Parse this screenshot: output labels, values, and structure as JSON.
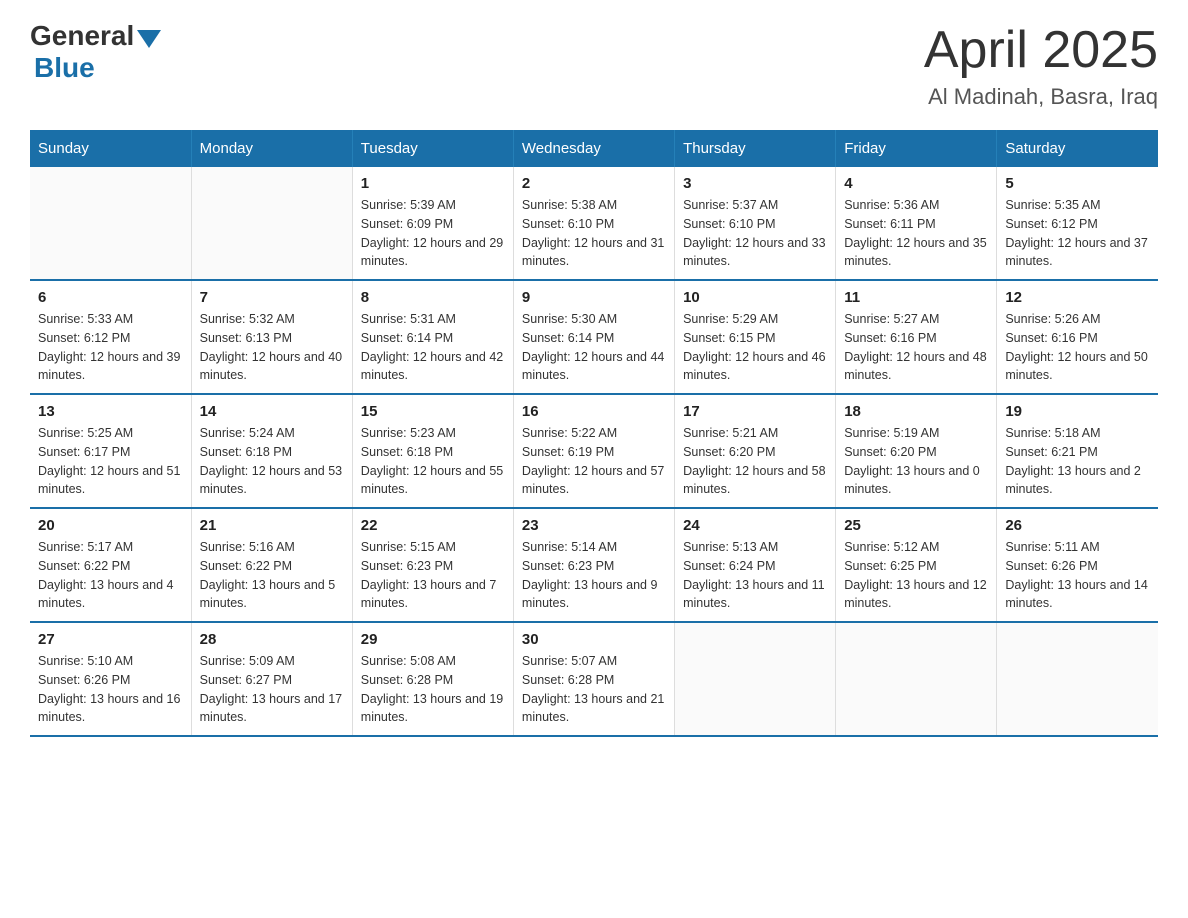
{
  "header": {
    "logo_general": "General",
    "logo_blue": "Blue",
    "title": "April 2025",
    "subtitle": "Al Madinah, Basra, Iraq"
  },
  "days_of_week": [
    "Sunday",
    "Monday",
    "Tuesday",
    "Wednesday",
    "Thursday",
    "Friday",
    "Saturday"
  ],
  "weeks": [
    [
      {
        "empty": true
      },
      {
        "empty": true
      },
      {
        "day": 1,
        "sunrise": "5:39 AM",
        "sunset": "6:09 PM",
        "daylight": "12 hours and 29 minutes."
      },
      {
        "day": 2,
        "sunrise": "5:38 AM",
        "sunset": "6:10 PM",
        "daylight": "12 hours and 31 minutes."
      },
      {
        "day": 3,
        "sunrise": "5:37 AM",
        "sunset": "6:10 PM",
        "daylight": "12 hours and 33 minutes."
      },
      {
        "day": 4,
        "sunrise": "5:36 AM",
        "sunset": "6:11 PM",
        "daylight": "12 hours and 35 minutes."
      },
      {
        "day": 5,
        "sunrise": "5:35 AM",
        "sunset": "6:12 PM",
        "daylight": "12 hours and 37 minutes."
      }
    ],
    [
      {
        "day": 6,
        "sunrise": "5:33 AM",
        "sunset": "6:12 PM",
        "daylight": "12 hours and 39 minutes."
      },
      {
        "day": 7,
        "sunrise": "5:32 AM",
        "sunset": "6:13 PM",
        "daylight": "12 hours and 40 minutes."
      },
      {
        "day": 8,
        "sunrise": "5:31 AM",
        "sunset": "6:14 PM",
        "daylight": "12 hours and 42 minutes."
      },
      {
        "day": 9,
        "sunrise": "5:30 AM",
        "sunset": "6:14 PM",
        "daylight": "12 hours and 44 minutes."
      },
      {
        "day": 10,
        "sunrise": "5:29 AM",
        "sunset": "6:15 PM",
        "daylight": "12 hours and 46 minutes."
      },
      {
        "day": 11,
        "sunrise": "5:27 AM",
        "sunset": "6:16 PM",
        "daylight": "12 hours and 48 minutes."
      },
      {
        "day": 12,
        "sunrise": "5:26 AM",
        "sunset": "6:16 PM",
        "daylight": "12 hours and 50 minutes."
      }
    ],
    [
      {
        "day": 13,
        "sunrise": "5:25 AM",
        "sunset": "6:17 PM",
        "daylight": "12 hours and 51 minutes."
      },
      {
        "day": 14,
        "sunrise": "5:24 AM",
        "sunset": "6:18 PM",
        "daylight": "12 hours and 53 minutes."
      },
      {
        "day": 15,
        "sunrise": "5:23 AM",
        "sunset": "6:18 PM",
        "daylight": "12 hours and 55 minutes."
      },
      {
        "day": 16,
        "sunrise": "5:22 AM",
        "sunset": "6:19 PM",
        "daylight": "12 hours and 57 minutes."
      },
      {
        "day": 17,
        "sunrise": "5:21 AM",
        "sunset": "6:20 PM",
        "daylight": "12 hours and 58 minutes."
      },
      {
        "day": 18,
        "sunrise": "5:19 AM",
        "sunset": "6:20 PM",
        "daylight": "13 hours and 0 minutes."
      },
      {
        "day": 19,
        "sunrise": "5:18 AM",
        "sunset": "6:21 PM",
        "daylight": "13 hours and 2 minutes."
      }
    ],
    [
      {
        "day": 20,
        "sunrise": "5:17 AM",
        "sunset": "6:22 PM",
        "daylight": "13 hours and 4 minutes."
      },
      {
        "day": 21,
        "sunrise": "5:16 AM",
        "sunset": "6:22 PM",
        "daylight": "13 hours and 5 minutes."
      },
      {
        "day": 22,
        "sunrise": "5:15 AM",
        "sunset": "6:23 PM",
        "daylight": "13 hours and 7 minutes."
      },
      {
        "day": 23,
        "sunrise": "5:14 AM",
        "sunset": "6:23 PM",
        "daylight": "13 hours and 9 minutes."
      },
      {
        "day": 24,
        "sunrise": "5:13 AM",
        "sunset": "6:24 PM",
        "daylight": "13 hours and 11 minutes."
      },
      {
        "day": 25,
        "sunrise": "5:12 AM",
        "sunset": "6:25 PM",
        "daylight": "13 hours and 12 minutes."
      },
      {
        "day": 26,
        "sunrise": "5:11 AM",
        "sunset": "6:26 PM",
        "daylight": "13 hours and 14 minutes."
      }
    ],
    [
      {
        "day": 27,
        "sunrise": "5:10 AM",
        "sunset": "6:26 PM",
        "daylight": "13 hours and 16 minutes."
      },
      {
        "day": 28,
        "sunrise": "5:09 AM",
        "sunset": "6:27 PM",
        "daylight": "13 hours and 17 minutes."
      },
      {
        "day": 29,
        "sunrise": "5:08 AM",
        "sunset": "6:28 PM",
        "daylight": "13 hours and 19 minutes."
      },
      {
        "day": 30,
        "sunrise": "5:07 AM",
        "sunset": "6:28 PM",
        "daylight": "13 hours and 21 minutes."
      },
      {
        "empty": true
      },
      {
        "empty": true
      },
      {
        "empty": true
      }
    ]
  ],
  "labels": {
    "sunrise": "Sunrise:",
    "sunset": "Sunset:",
    "daylight": "Daylight:"
  }
}
